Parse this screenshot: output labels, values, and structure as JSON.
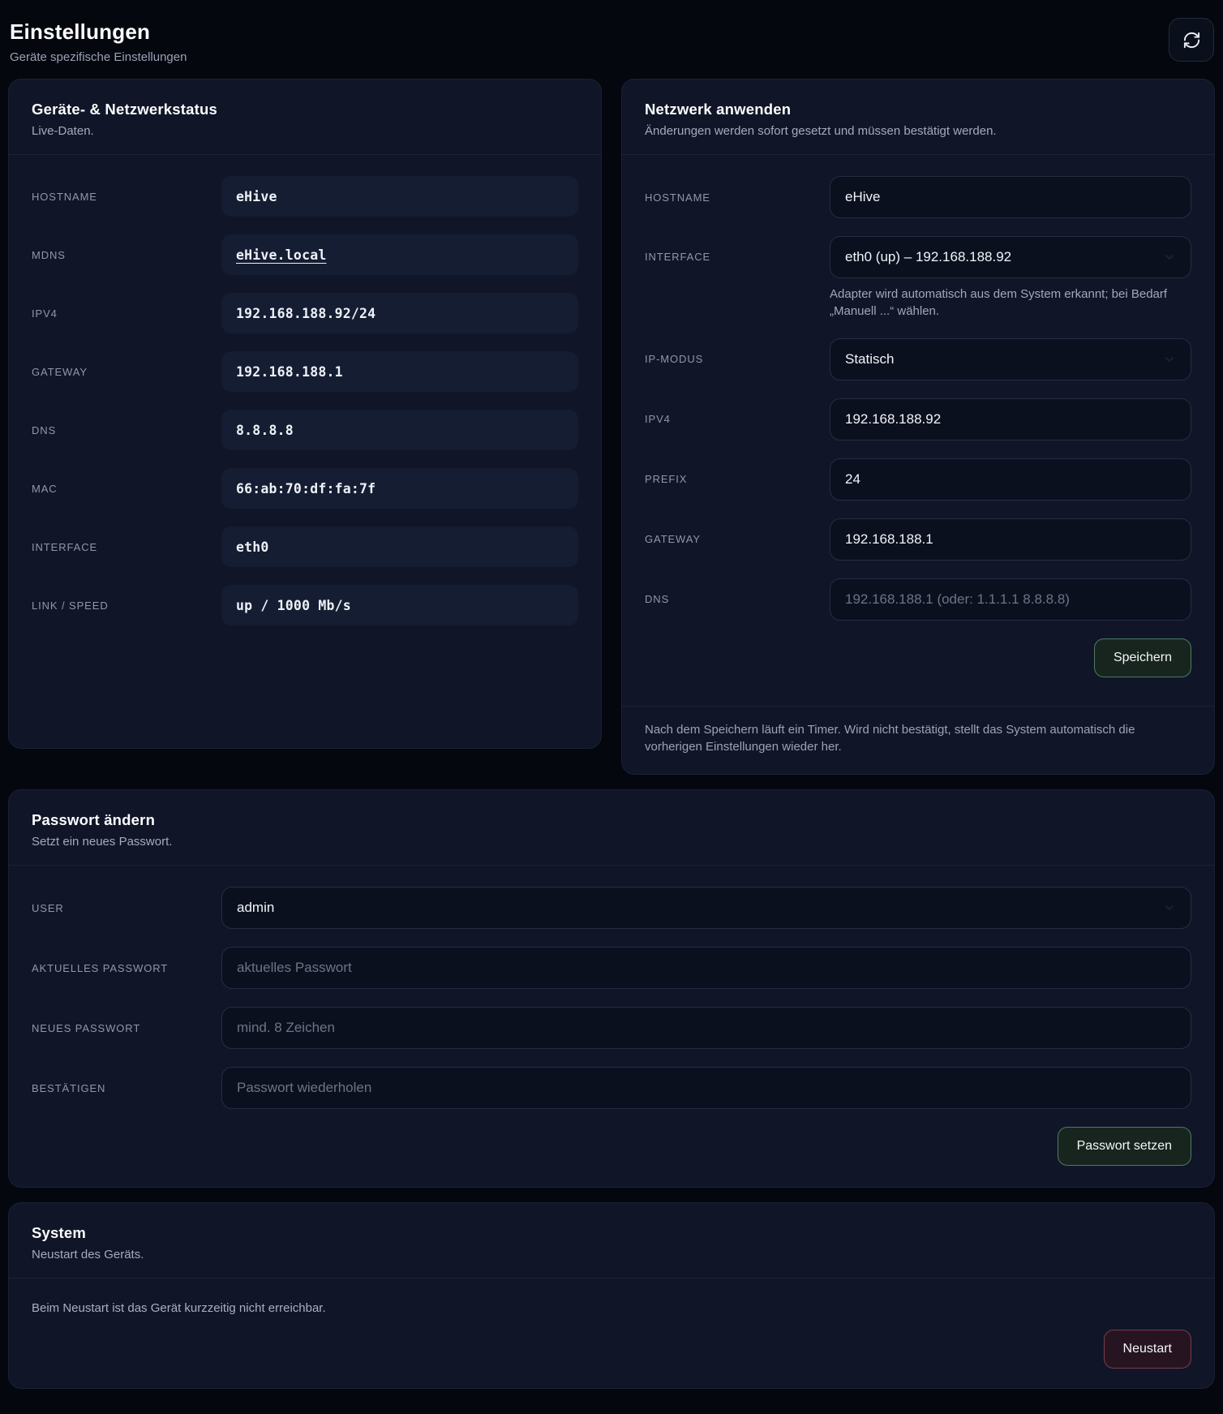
{
  "page": {
    "title": "Einstellungen",
    "subtitle": "Geräte spezifische Einstellungen"
  },
  "status_card": {
    "title": "Geräte- & Netzwerkstatus",
    "subtitle": "Live-Daten.",
    "rows": [
      {
        "label": "HOSTNAME",
        "value": "eHive",
        "link": false
      },
      {
        "label": "MDNS",
        "value": "eHive.local",
        "link": true
      },
      {
        "label": "IPV4",
        "value": "192.168.188.92/24",
        "link": false
      },
      {
        "label": "GATEWAY",
        "value": "192.168.188.1",
        "link": false
      },
      {
        "label": "DNS",
        "value": "8.8.8.8",
        "link": false
      },
      {
        "label": "MAC",
        "value": "66:ab:70:df:fa:7f",
        "link": false
      },
      {
        "label": "INTERFACE",
        "value": "eth0",
        "link": false
      },
      {
        "label": "LINK / SPEED",
        "value": "up / 1000 Mb/s",
        "link": false
      }
    ]
  },
  "network_card": {
    "title": "Netzwerk anwenden",
    "subtitle": "Änderungen werden sofort gesetzt und müssen bestätigt werden.",
    "hostname": {
      "label": "HOSTNAME",
      "value": "eHive"
    },
    "interface": {
      "label": "INTERFACE",
      "value": "eth0 (up) – 192.168.188.92",
      "help": "Adapter wird automatisch aus dem System erkannt; bei Bedarf „Manuell ...“ wählen."
    },
    "ip_mode": {
      "label": "IP-MODUS",
      "value": "Statisch"
    },
    "ipv4": {
      "label": "IPV4",
      "value": "192.168.188.92"
    },
    "prefix": {
      "label": "PREFIX",
      "value": "24"
    },
    "gateway": {
      "label": "GATEWAY",
      "value": "192.168.188.1"
    },
    "dns": {
      "label": "DNS",
      "placeholder": "192.168.188.1 (oder: 1.1.1.1 8.8.8.8)"
    },
    "save_label": "Speichern",
    "footer": "Nach dem Speichern läuft ein Timer. Wird nicht bestätigt, stellt das System automatisch die vorherigen Einstellungen wieder her."
  },
  "password_card": {
    "title": "Passwort ändern",
    "subtitle": "Setzt ein neues Passwort.",
    "user": {
      "label": "USER",
      "value": "admin"
    },
    "current": {
      "label": "AKTUELLES PASSWORT",
      "placeholder": "aktuelles Passwort"
    },
    "new": {
      "label": "NEUES PASSWORT",
      "placeholder": "mind. 8 Zeichen"
    },
    "confirm": {
      "label": "BESTÄTIGEN",
      "placeholder": "Passwort wiederholen"
    },
    "submit_label": "Passwort setzen"
  },
  "system_card": {
    "title": "System",
    "subtitle": "Neustart des Geräts.",
    "note": "Beim Neustart ist das Gerät kurzzeitig nicht erreichbar.",
    "restart_label": "Neustart"
  },
  "colors": {
    "page_bg": "#05070f",
    "card_bg": "#101628",
    "input_bg": "#0b101f",
    "accent_green_border": "#4d7a60",
    "accent_red_border": "#7c3b49"
  }
}
